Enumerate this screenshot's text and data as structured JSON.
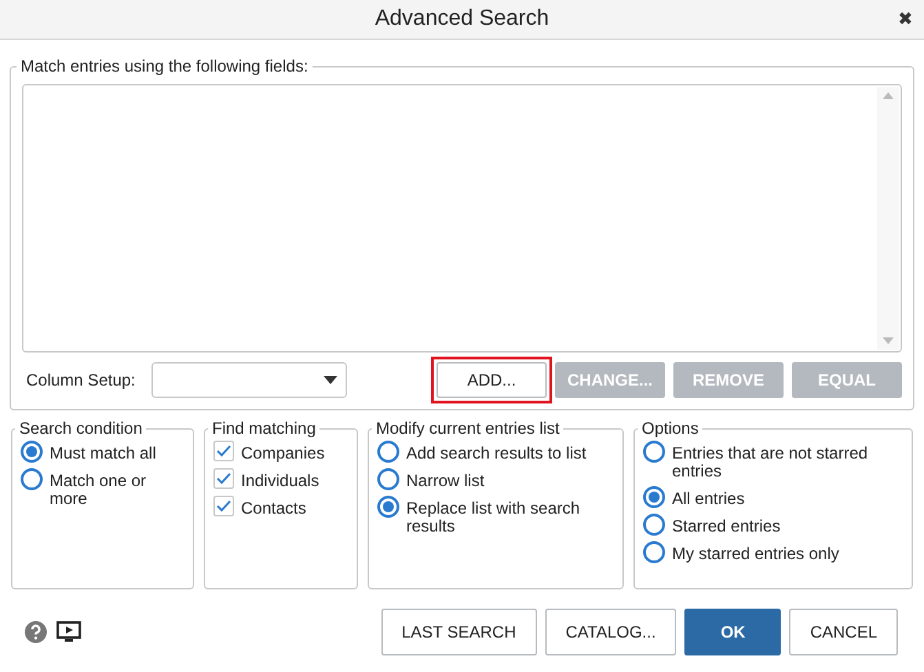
{
  "window": {
    "title": "Advanced Search",
    "close": "✖"
  },
  "match_fields": {
    "legend": "Match entries using the following fields:",
    "column_setup_label": "Column Setup:",
    "buttons": [
      {
        "label": "ADD...",
        "disabled": false,
        "highlighted": true
      },
      {
        "label": "CHANGE...",
        "disabled": true,
        "highlighted": false
      },
      {
        "label": "REMOVE",
        "disabled": true,
        "highlighted": false
      },
      {
        "label": "EQUAL",
        "disabled": true,
        "highlighted": false
      }
    ]
  },
  "groups": [
    {
      "title": "Search condition",
      "kind": "radio",
      "items": [
        {
          "label": "Must match all",
          "selected": true
        },
        {
          "label": "Match one or more",
          "selected": false
        }
      ]
    },
    {
      "title": "Find matching",
      "kind": "checkbox",
      "items": [
        {
          "label": "Companies",
          "checked": true
        },
        {
          "label": "Individuals",
          "checked": true
        },
        {
          "label": "Contacts",
          "checked": true
        }
      ]
    },
    {
      "title": "Modify current entries list",
      "kind": "radio",
      "items": [
        {
          "label": "Add search results to list",
          "selected": false
        },
        {
          "label": "Narrow list",
          "selected": false
        },
        {
          "label": "Replace list with search results",
          "selected": true
        }
      ]
    },
    {
      "title": "Options",
      "kind": "radio",
      "items": [
        {
          "label": "Entries that are not starred entries",
          "selected": false
        },
        {
          "label": "All entries",
          "selected": true
        },
        {
          "label": "Starred entries",
          "selected": false
        },
        {
          "label": "My starred entries only",
          "selected": false
        }
      ]
    }
  ],
  "footer_buttons": [
    {
      "label": "LAST SEARCH",
      "kind": "normal"
    },
    {
      "label": "CATALOG...",
      "kind": "normal"
    },
    {
      "label": "OK",
      "kind": "primary"
    },
    {
      "label": "CANCEL",
      "kind": "normal"
    }
  ]
}
